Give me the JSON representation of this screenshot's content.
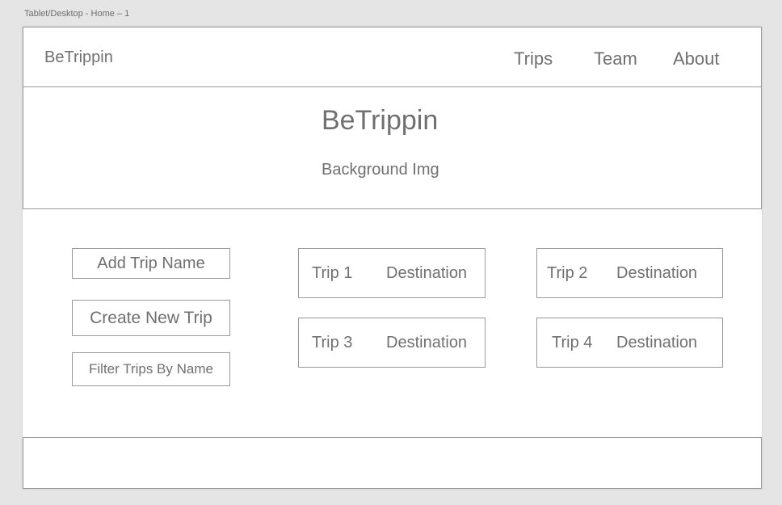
{
  "canvas": {
    "artboard_label": "Tablet/Desktop - Home – 1"
  },
  "navbar": {
    "brand": "BeTrippin",
    "links": [
      "Trips",
      "Team",
      "About"
    ]
  },
  "hero": {
    "title": "BeTrippin",
    "subtitle": "Background Img"
  },
  "actions": {
    "add_trip_name": "Add Trip Name",
    "create_new_trip": "Create New Trip",
    "filter_trips": "Filter Trips By Name"
  },
  "trips": [
    {
      "name": "Trip 1",
      "destination": "Destination"
    },
    {
      "name": "Trip 2",
      "destination": "Destination"
    },
    {
      "name": "Trip 3",
      "destination": "Destination"
    },
    {
      "name": "Trip 4",
      "destination": "Destination"
    }
  ],
  "colors": {
    "canvas_background": "#e5e5e5",
    "artboard_background": "#ffffff",
    "wireframe_border": "#9a9a9a",
    "wireframe_text": "#707070"
  }
}
